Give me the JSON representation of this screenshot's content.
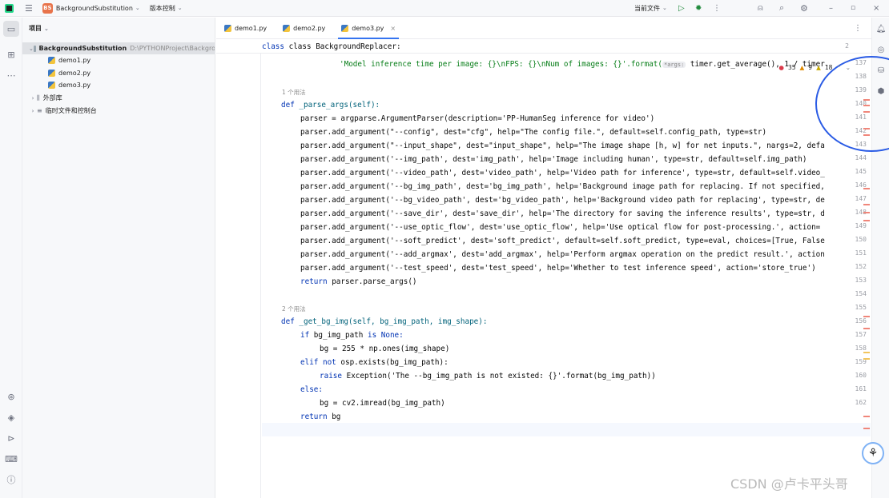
{
  "titlebar": {
    "project_badge": "BS",
    "project_name": "BackgroundSubstitution",
    "vcs_label": "版本控制",
    "run_config": "当前文件"
  },
  "project_panel": {
    "header": "项目",
    "root_name": "BackgroundSubstitution",
    "root_path": "D:\\PYTHONProject\\Backgro",
    "files": [
      "demo1.py",
      "demo2.py",
      "demo3.py"
    ],
    "external_libs": "外部库",
    "scratches": "临时文件和控制台"
  },
  "tabs": [
    {
      "label": "demo1.py"
    },
    {
      "label": "demo2.py"
    },
    {
      "label": "demo3.py",
      "close": "×"
    }
  ],
  "sticky": {
    "line": "2",
    "text": "class BackgroundReplacer:"
  },
  "inspections": {
    "errors": "35",
    "warnings": "9",
    "weak": "18"
  },
  "usages": {
    "u1": "1 个用法",
    "u2": "2 个用法"
  },
  "code_lines": {
    "l137": "'Model inference time per image: {}\\nFPS: {}\\nNum of images: {}'.format(",
    "l137_hint": "*args:",
    "l137_tail": " timer.get_average(), 1 / timer.",
    "l139": "_parse_args(self):",
    "l140": "parser = argparse.ArgumentParser(description='PP-HumanSeg inference for video')",
    "l141": "parser.add_argument(\"--config\", dest=\"cfg\", help=\"The config file.\", default=self.config_path, type=str)",
    "l142": "parser.add_argument(\"--input_shape\", dest=\"input_shape\", help=\"The image shape [h, w] for net inputs.\", nargs=2, defa",
    "l143": "parser.add_argument('--img_path', dest='img_path', help='Image including human', type=str, default=self.img_path)",
    "l144": "parser.add_argument('--video_path', dest='video_path', help='Video path for inference', type=str, default=self.video_",
    "l145": "parser.add_argument('--bg_img_path', dest='bg_img_path', help='Background image path for replacing. If not specified,",
    "l146": "parser.add_argument('--bg_video_path', dest='bg_video_path', help='Background video path for replacing', type=str, de",
    "l147": "parser.add_argument('--save_dir', dest='save_dir', help='The directory for saving the inference results', type=str, d",
    "l148": "parser.add_argument('--use_optic_flow', dest='use_optic_flow', help='Use optical flow for post-processing.', action=",
    "l149": "parser.add_argument('--soft_predict', dest='soft_predict', default=self.soft_predict, type=eval, choices=[True, False",
    "l150": "parser.add_argument('--add_argmax', dest='add_argmax', help='Perform argmax operation on the predict result.', action",
    "l151": "parser.add_argument('--test_speed', dest='test_speed', help='Whether to test inference speed', action='store_true')",
    "l152": "parser.parse_args()",
    "l154": "_get_bg_img(self, bg_img_path, img_shape):",
    "l155": "bg_img_path ",
    "l155b": "None:",
    "l156": "bg = 255 * np.ones(img_shape)",
    "l157": "osp.exists(bg_img_path):",
    "l158": "Exception('The --bg_img_path is not existed: {}'.format(bg_img_path))",
    "l160": "bg = cv2.imread(bg_img_path)",
    "l161": "bg"
  },
  "keywords": {
    "def": "def ",
    "if": "if ",
    "is": "is ",
    "elif": "elif not ",
    "raise": "raise ",
    "else": "else:",
    "return": "return ",
    "class": "class"
  },
  "line_numbers": [
    "137",
    "138",
    "139",
    "140",
    "141",
    "142",
    "143",
    "144",
    "145",
    "146",
    "147",
    "148",
    "149",
    "150",
    "151",
    "152",
    "153",
    "154",
    "155",
    "156",
    "157",
    "158",
    "159",
    "160",
    "161",
    "162"
  ],
  "watermark": "CSDN @卢卡平头哥",
  "colors": {
    "accent": "#3574f0",
    "keyword": "#0033b3",
    "string": "#067d17",
    "annotation": "#2b5ce5"
  }
}
